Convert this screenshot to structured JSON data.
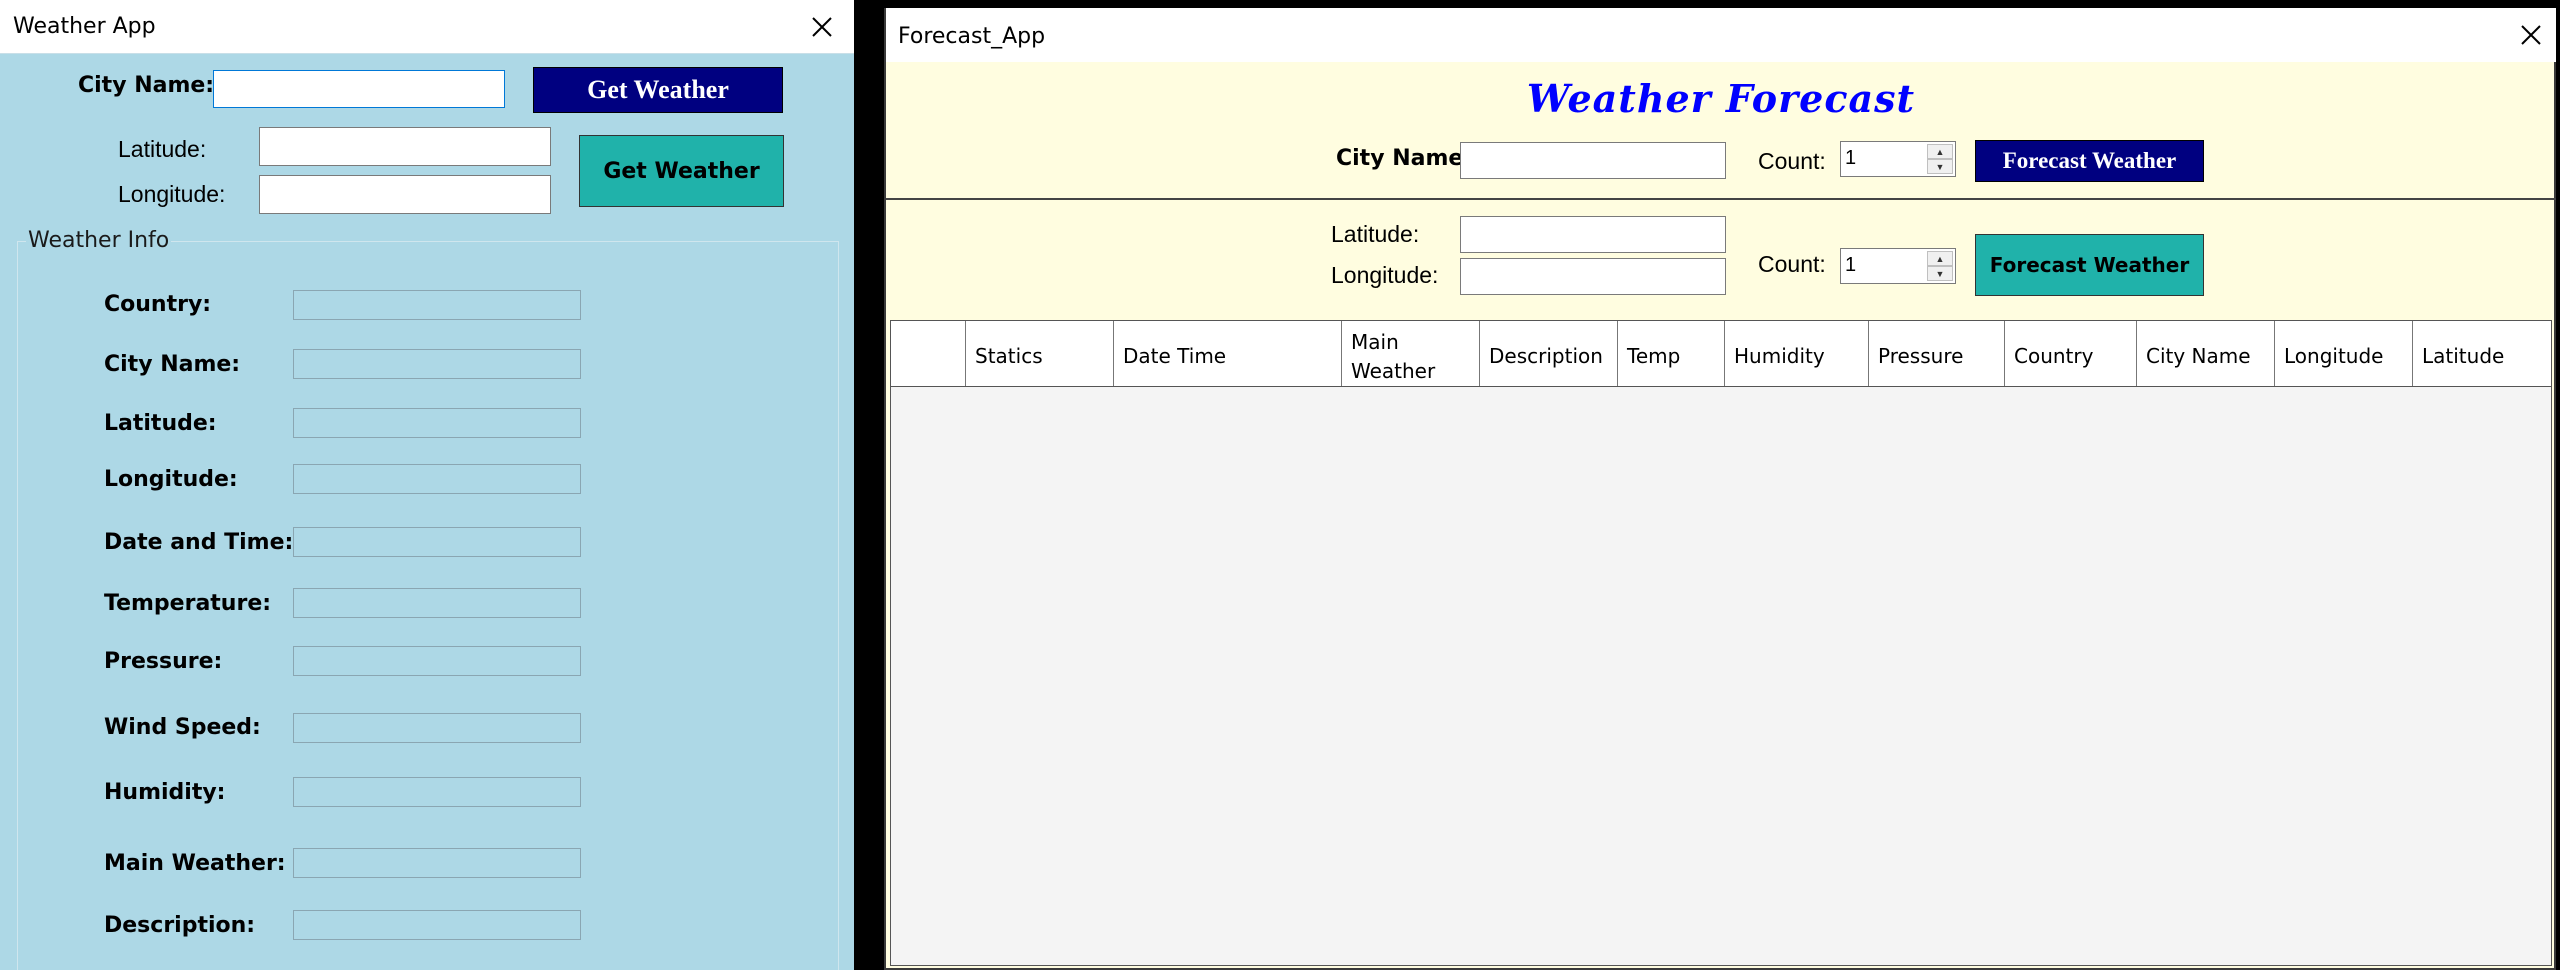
{
  "weather_app": {
    "title": "Weather App",
    "city_label": "City Name:",
    "city_value": "",
    "get_weather_city_button": "Get Weather",
    "latitude_label": "Latitude:",
    "longitude_label": "Longitude:",
    "get_weather_coords_button": "Get Weather",
    "group_title": "Weather Info",
    "fields": [
      {
        "label": "Country:",
        "value": ""
      },
      {
        "label": "City Name:",
        "value": ""
      },
      {
        "label": "Latitude:",
        "value": ""
      },
      {
        "label": "Longitude:",
        "value": ""
      },
      {
        "label": "Date and Time:",
        "value": ""
      },
      {
        "label": "Temperature:",
        "value": ""
      },
      {
        "label": "Pressure:",
        "value": ""
      },
      {
        "label": "Wind Speed:",
        "value": ""
      },
      {
        "label": "Humidity:",
        "value": ""
      },
      {
        "label": "Main Weather:",
        "value": ""
      },
      {
        "label": "Description:",
        "value": ""
      }
    ]
  },
  "forecast_app": {
    "title": "Forecast_App",
    "heading": "Weather Forecast",
    "city_label": "City Name:",
    "count_label_1": "Count:",
    "count_value_1": "1",
    "forecast_city_button": "Forecast Weather",
    "latitude_label": "Latitude:",
    "longitude_label": "Longitude:",
    "count_label_2": "Count:",
    "count_value_2": "1",
    "forecast_coords_button": "Forecast Weather",
    "columns": [
      "",
      "Statics",
      "Date Time",
      "Main Weather",
      "Description",
      "Temp",
      "Humidity",
      "Pressure",
      "Country",
      "City Name",
      "Longitude",
      "Latitude"
    ]
  },
  "colors": {
    "weather_bg": "#add8e6",
    "forecast_bg": "#fffde0",
    "navy_button": "#000080",
    "teal_button": "#20b2aa",
    "heading": "#0000ff"
  },
  "icons": {
    "close": "close-icon",
    "spin_up": "chevron-up-icon",
    "spin_down": "chevron-down-icon"
  }
}
